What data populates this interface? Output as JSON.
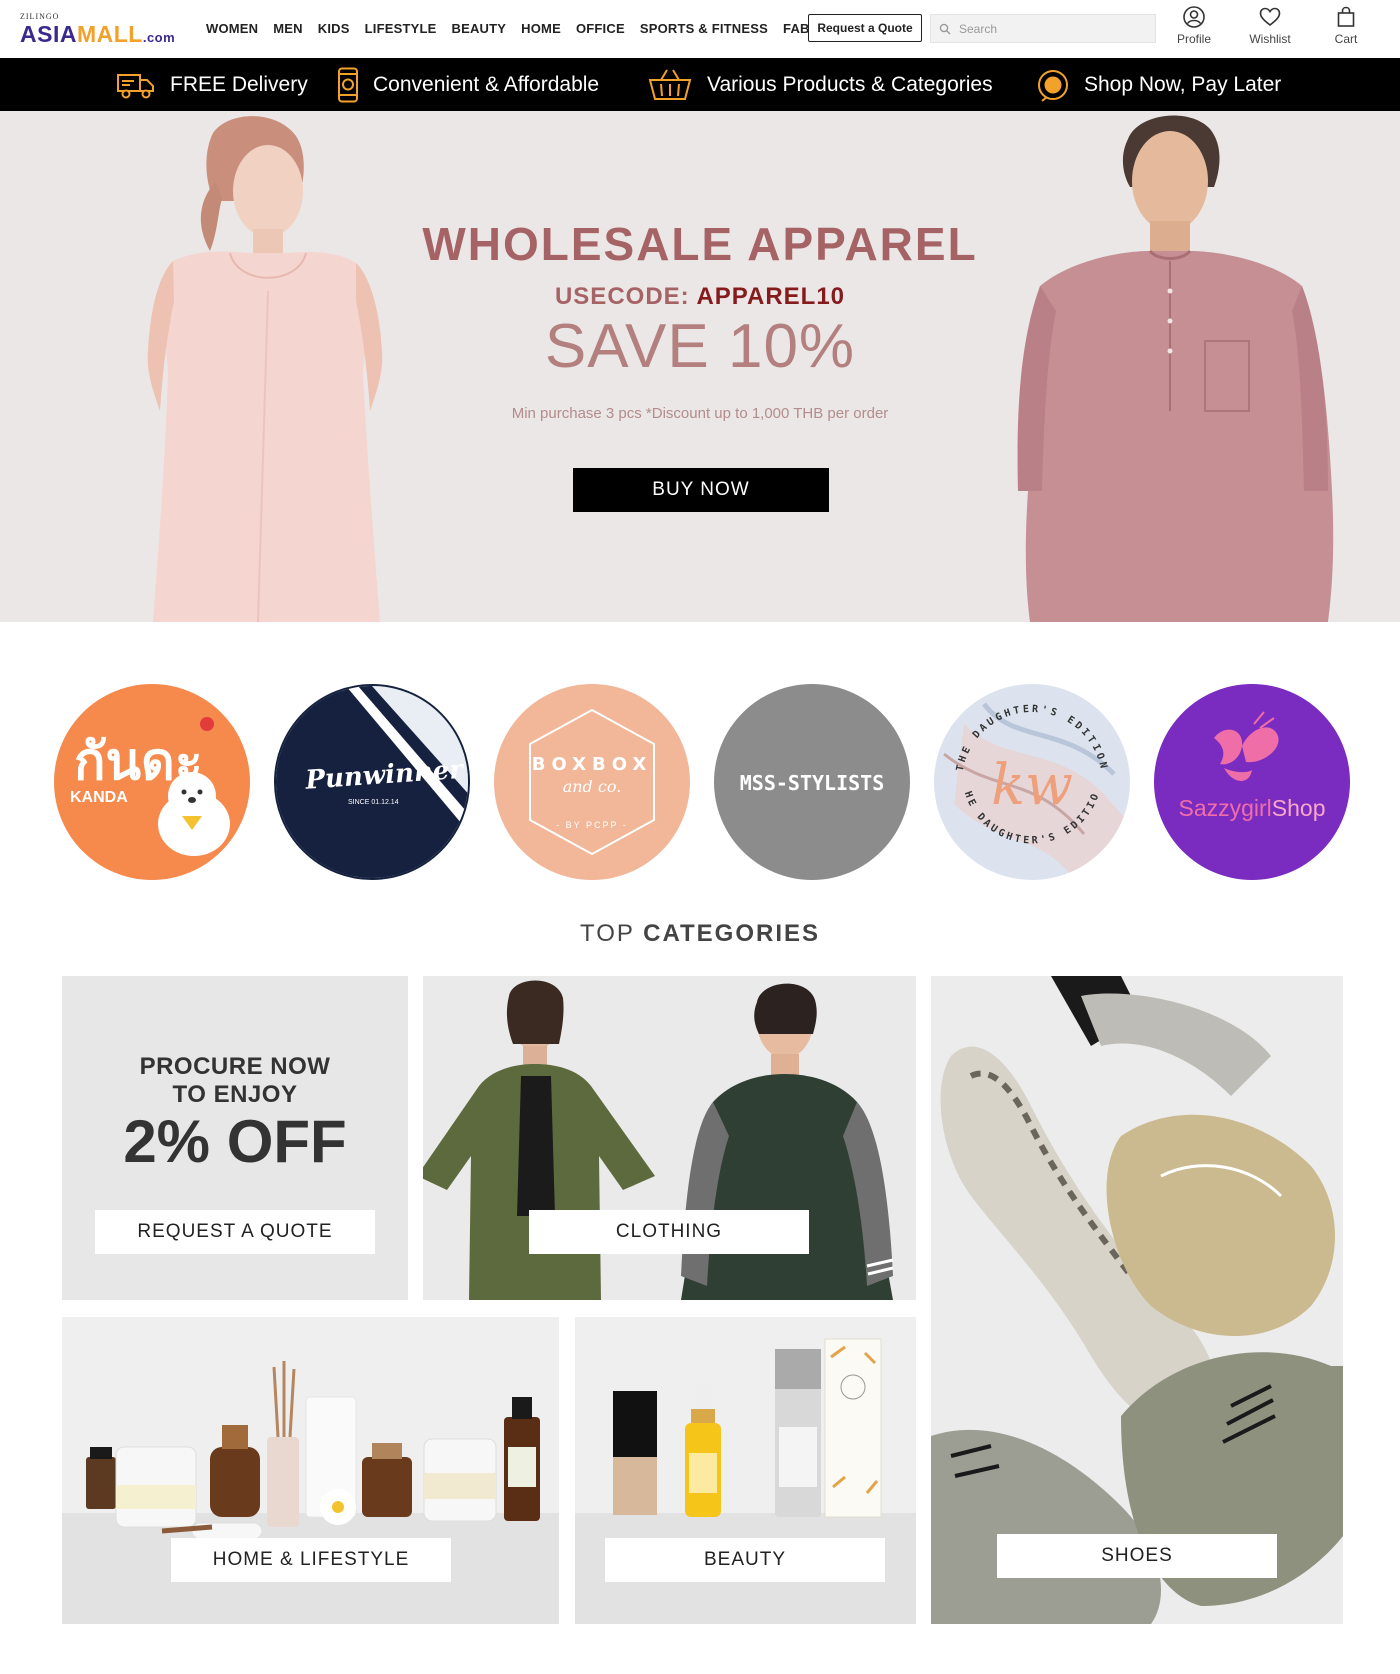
{
  "header": {
    "logo": {
      "sup": "ZILINGO",
      "part1": "ASIA",
      "part2": "MALL",
      "part3": ".com"
    },
    "nav": [
      "WOMEN",
      "MEN",
      "KIDS",
      "LIFESTYLE",
      "BEAUTY",
      "HOME",
      "OFFICE",
      "SPORTS & FITNESS",
      "FABRIC"
    ],
    "quote_button": "Request a Quote",
    "search_placeholder": "Search",
    "profile_label": "Profile",
    "wishlist_label": "Wishlist",
    "cart_label": "Cart"
  },
  "benefits": [
    "FREE Delivery",
    "Convenient & Affordable",
    "Various Products & Categories",
    "Shop Now, Pay Later"
  ],
  "hero": {
    "title": "WHOLESALE  APPAREL",
    "code_label": "USECODE: ",
    "code_value": "APPAREL10",
    "save": "SAVE 10%",
    "note": "Min purchase 3 pcs *Discount up to 1,000 THB per order",
    "button": "BUY NOW"
  },
  "brands": {
    "kanda_thai": "กันดะ",
    "kanda": "KANDA",
    "punwinner": "Punwinner",
    "punwinner_since": "SINCE 01.12.14",
    "boxbox": "BOXBOX",
    "boxbox_and": "and co.",
    "boxbox_by": "- BY PCPP -",
    "mss": "MSS-STYLISTS",
    "daughters_text": "THE DAUGHTER'S EDITION",
    "daughters_mark": "kw",
    "sazzy": "SazzygirlShop",
    "sazzy_part1": "Sazzygirl",
    "sazzy_part2": "Shop"
  },
  "categories": {
    "title_light": "TOP ",
    "title_bold": "CATEGORIES",
    "promo": {
      "line1": "PROCURE NOW",
      "line2": "TO ENJOY",
      "line3": "2% OFF",
      "button": "REQUEST A QUOTE"
    },
    "clothing": "CLOTHING",
    "shoes": "SHOES",
    "home_lifestyle": "HOME & LIFESTYLE",
    "beauty": "BEAUTY"
  },
  "colors": {
    "brand_purple": "#3a2a8f",
    "brand_orange": "#f2a12b",
    "hero_bg": "#ebe7e6",
    "hero_accent": "#a66366"
  }
}
